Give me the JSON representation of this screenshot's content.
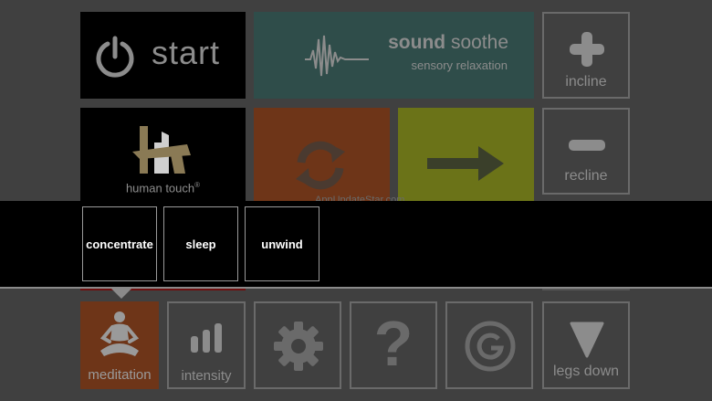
{
  "tiles": {
    "start": {
      "label": "start",
      "icon": "power-icon"
    },
    "sound_soothe": {
      "title_bold": "sound",
      "title_rest": " soothe",
      "subtitle": "sensory relaxation",
      "icon": "waveform-icon"
    },
    "incline": {
      "label": "incline",
      "icon": "plus-icon"
    },
    "brand": {
      "label": "human touch",
      "mark": "®",
      "icon": "human-touch-logo"
    },
    "cycle": {
      "icon": "refresh-icon"
    },
    "next": {
      "icon": "arrow-right-icon"
    },
    "recline": {
      "label": "recline",
      "icon": "minus-icon"
    },
    "meditation": {
      "label": "meditation",
      "icon": "meditation-icon"
    },
    "intensity": {
      "label": "intensity",
      "icon": "signal-bars-icon"
    },
    "settings": {
      "icon": "gear-icon"
    },
    "help": {
      "glyph": "?",
      "icon": "question-icon"
    },
    "g_button": {
      "icon": "g-logo-icon"
    },
    "legs_down": {
      "label": "legs down",
      "icon": "triangle-down-icon"
    }
  },
  "submenu": {
    "items": [
      "concentrate",
      "sleep",
      "unwind"
    ]
  },
  "watermark": "AppUpdateStar.com",
  "colors": {
    "background": "#404040",
    "sound_tile": "#2f4d4a",
    "orange_tile": "#6e3518",
    "green_tile": "#6b7318",
    "icon_gray": "#8c8c8c"
  }
}
